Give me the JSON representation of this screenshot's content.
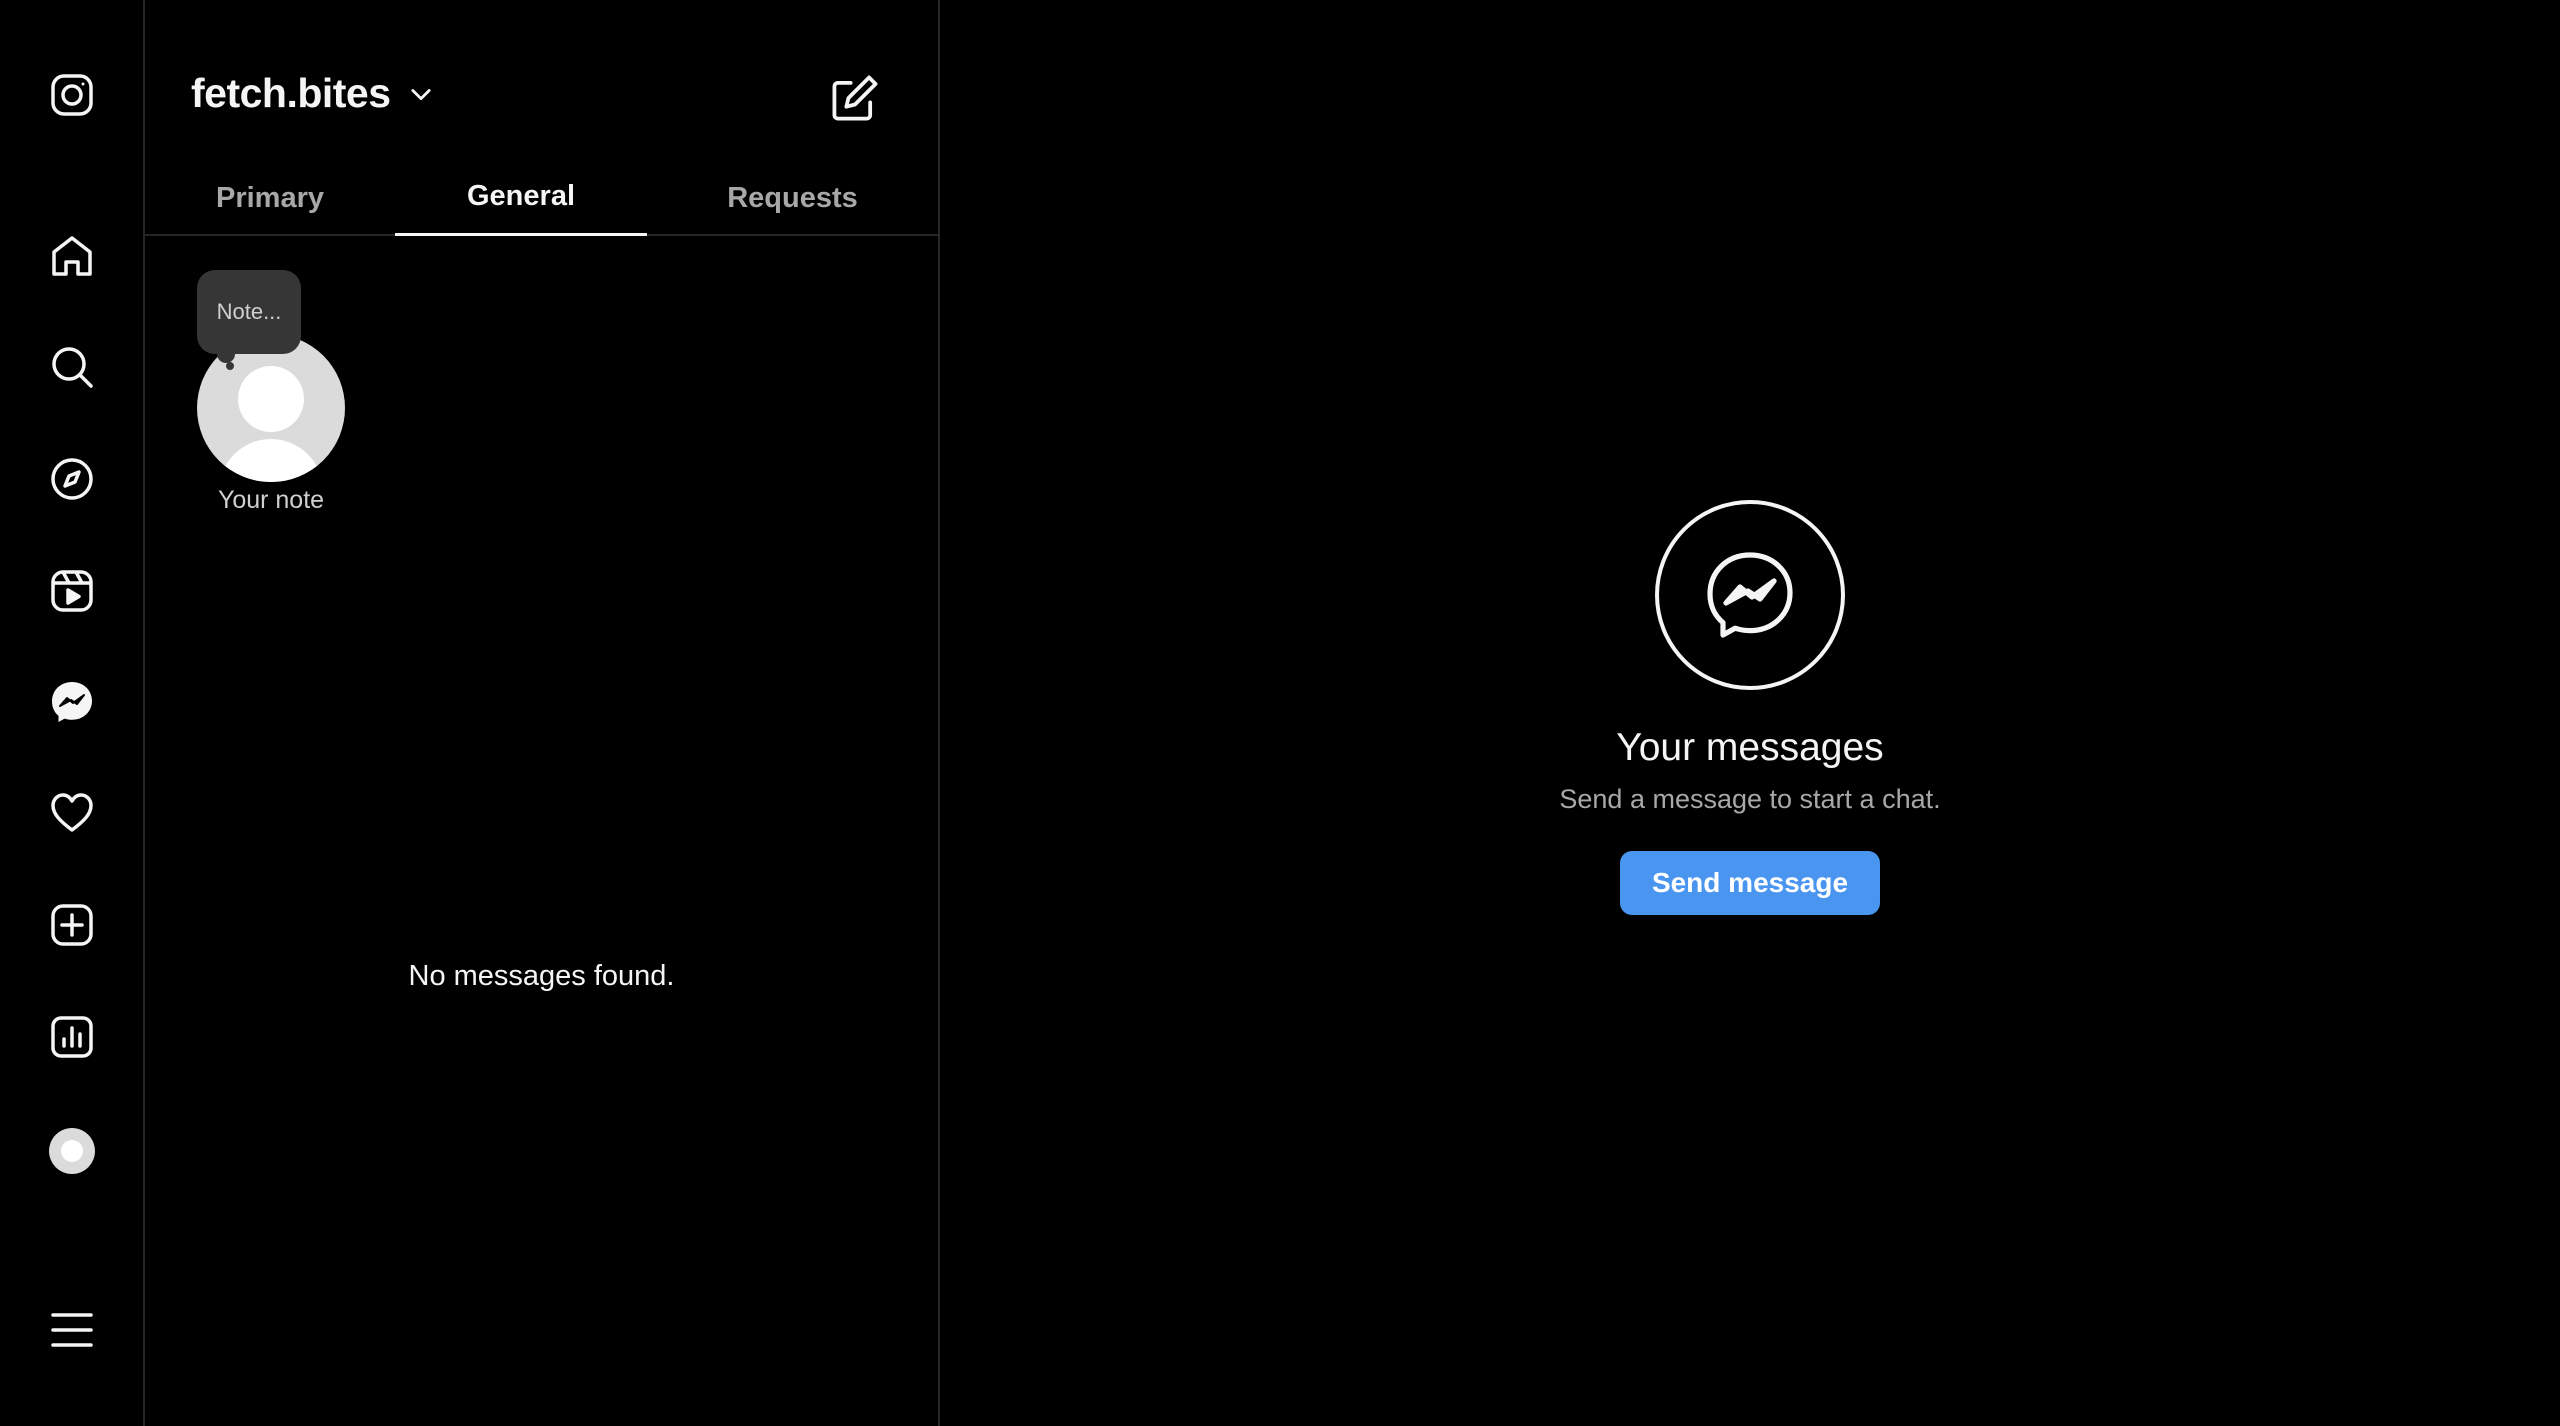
{
  "sidebar": {
    "items": [
      {
        "icon": "instagram-logo-icon"
      },
      {
        "icon": "home-icon"
      },
      {
        "icon": "search-icon"
      },
      {
        "icon": "explore-compass-icon"
      },
      {
        "icon": "reels-icon"
      },
      {
        "icon": "messenger-icon"
      },
      {
        "icon": "heart-icon"
      },
      {
        "icon": "create-plus-icon"
      },
      {
        "icon": "dashboard-chart-icon"
      },
      {
        "icon": "profile-avatar-icon"
      },
      {
        "icon": "menu-hamburger-icon"
      }
    ]
  },
  "inbox": {
    "account_name": "fetch.bites",
    "tabs": [
      {
        "label": "Primary",
        "active": false
      },
      {
        "label": "General",
        "active": true
      },
      {
        "label": "Requests",
        "active": false
      }
    ],
    "note": {
      "bubble_text": "Note...",
      "label": "Your note"
    },
    "empty_text": "No messages found."
  },
  "main": {
    "title": "Your messages",
    "subtitle": "Send a message to start a chat.",
    "button_label": "Send message"
  },
  "colors": {
    "background": "#000000",
    "text": "#f5f5f5",
    "muted": "#a8a8a8",
    "accent": "#4a95f0",
    "divider": "#262626"
  }
}
